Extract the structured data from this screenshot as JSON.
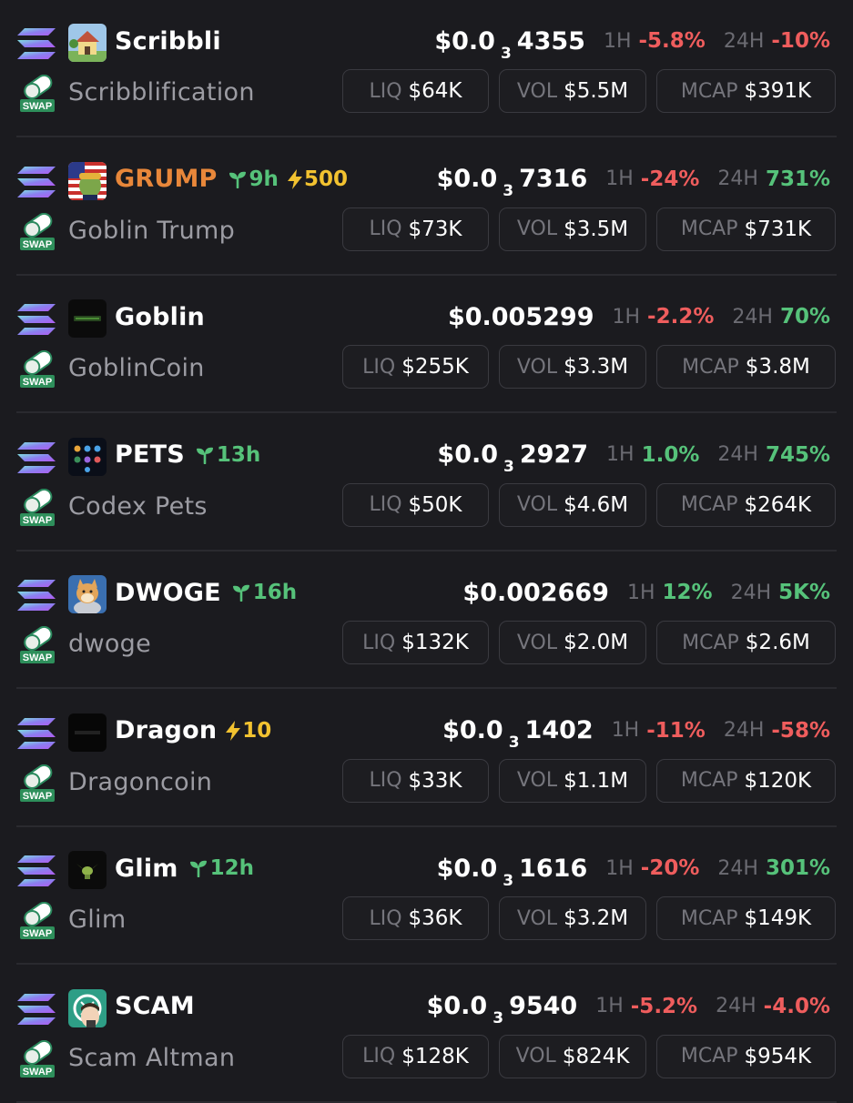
{
  "tokens": [
    {
      "symbol": "Scribbli",
      "name": "Scribblification",
      "highlight": false,
      "age": null,
      "boost": null,
      "avatar": "scribbli-house-avatar",
      "price": {
        "lead": "$0.0",
        "zeros": "3",
        "tail": "4355"
      },
      "h1": "-5.8%",
      "h1_dir": "neg",
      "h24": "-10%",
      "h24_dir": "neg",
      "liq": "$64K",
      "vol": "$5.5M",
      "mcap": "$391K"
    },
    {
      "symbol": "GRUMP",
      "name": "Goblin Trump",
      "highlight": true,
      "age": "9h",
      "boost": "500",
      "avatar": "goblin-trump-flag-avatar",
      "price": {
        "lead": "$0.0",
        "zeros": "3",
        "tail": "7316"
      },
      "h1": "-24%",
      "h1_dir": "neg",
      "h24": "731%",
      "h24_dir": "pos",
      "liq": "$73K",
      "vol": "$3.5M",
      "mcap": "$731K"
    },
    {
      "symbol": "Goblin",
      "name": "GoblinCoin",
      "highlight": false,
      "age": null,
      "boost": null,
      "avatar": "goblincoin-dark-avatar",
      "price": {
        "lead": "$0.005299",
        "zeros": "",
        "tail": ""
      },
      "h1": "-2.2%",
      "h1_dir": "neg",
      "h24": "70%",
      "h24_dir": "pos",
      "liq": "$255K",
      "vol": "$3.3M",
      "mcap": "$3.8M"
    },
    {
      "symbol": "PETS",
      "name": "Codex Pets",
      "highlight": false,
      "age": "13h",
      "boost": null,
      "avatar": "codex-pets-grid-avatar",
      "price": {
        "lead": "$0.0",
        "zeros": "3",
        "tail": "2927"
      },
      "h1": "1.0%",
      "h1_dir": "pos",
      "h24": "745%",
      "h24_dir": "pos",
      "liq": "$50K",
      "vol": "$4.6M",
      "mcap": "$264K"
    },
    {
      "symbol": "DWOGE",
      "name": "dwoge",
      "highlight": false,
      "age": "16h",
      "boost": null,
      "avatar": "dwoge-dog-avatar",
      "price": {
        "lead": "$0.002669",
        "zeros": "",
        "tail": ""
      },
      "h1": "12%",
      "h1_dir": "pos",
      "h24": "5K%",
      "h24_dir": "pos",
      "liq": "$132K",
      "vol": "$2.0M",
      "mcap": "$2.6M"
    },
    {
      "symbol": "Dragon",
      "name": "Dragoncoin",
      "highlight": false,
      "age": null,
      "boost": "10",
      "avatar": "dragoncoin-dark-avatar",
      "price": {
        "lead": "$0.0",
        "zeros": "3",
        "tail": "1402"
      },
      "h1": "-11%",
      "h1_dir": "neg",
      "h24": "-58%",
      "h24_dir": "neg",
      "liq": "$33K",
      "vol": "$1.1M",
      "mcap": "$120K"
    },
    {
      "symbol": "Glim",
      "name": "Glim",
      "highlight": false,
      "age": "12h",
      "boost": null,
      "avatar": "glim-creature-avatar",
      "price": {
        "lead": "$0.0",
        "zeros": "3",
        "tail": "1616"
      },
      "h1": "-20%",
      "h1_dir": "neg",
      "h24": "301%",
      "h24_dir": "pos",
      "liq": "$36K",
      "vol": "$3.2M",
      "mcap": "$149K"
    },
    {
      "symbol": "SCAM",
      "name": "Scam Altman",
      "highlight": false,
      "age": null,
      "boost": null,
      "avatar": "scam-altman-avatar",
      "price": {
        "lead": "$0.0",
        "zeros": "3",
        "tail": "9540"
      },
      "h1": "-5.2%",
      "h1_dir": "neg",
      "h24": "-4.0%",
      "h24_dir": "neg",
      "liq": "$128K",
      "vol": "$824K",
      "mcap": "$954K"
    }
  ],
  "labels": {
    "h1": "1H",
    "h24": "24H",
    "liq": "LIQ",
    "vol": "VOL",
    "mcap": "MCAP",
    "swap": "SWAP"
  },
  "colors": {
    "background": "#1b1b1f",
    "negative": "#ef5d5d",
    "positive": "#56c27a",
    "boost": "#f2c230",
    "highlight": "#e8873a"
  },
  "icons": {
    "chain": "solana-icon",
    "swap": "swap-pill-icon",
    "age": "seedling-icon",
    "boost": "lightning-icon"
  }
}
